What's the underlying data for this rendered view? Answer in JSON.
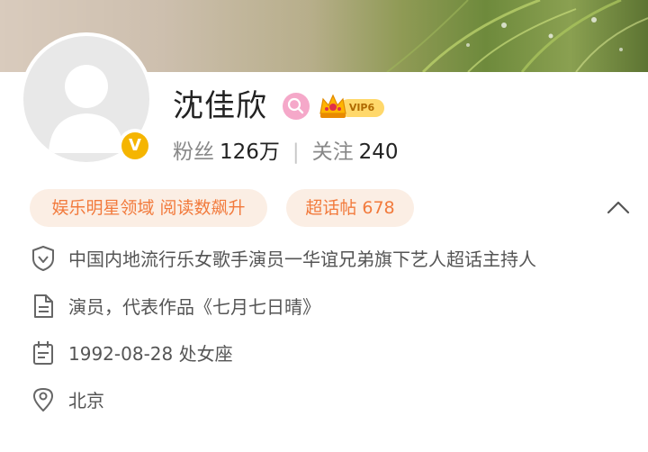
{
  "profile": {
    "name": "沈佳欣",
    "vip_label": "VIP6",
    "verified_mark": "V"
  },
  "stats": {
    "fans_label": "粉丝",
    "fans_value": "126万",
    "separator": "|",
    "following_label": "关注",
    "following_value": "240"
  },
  "tags": [
    {
      "label": "娱乐明星领域 阅读数飙升"
    },
    {
      "label": "超话帖 678"
    }
  ],
  "info": [
    {
      "icon": "shield-icon",
      "text": "中国内地流行乐女歌手演员一华谊兄弟旗下艺人超话主持人"
    },
    {
      "icon": "document-icon",
      "text": "演员，代表作品《七月七日晴》"
    },
    {
      "icon": "calendar-icon",
      "text": "1992-08-28 处女座"
    },
    {
      "icon": "location-pin-icon",
      "text": "北京"
    }
  ],
  "colors": {
    "accent_orange": "#f27a3c",
    "tag_bg": "#fbeee4",
    "verified_yellow": "#f5b500",
    "search_badge_pink": "#f5a8c9"
  }
}
